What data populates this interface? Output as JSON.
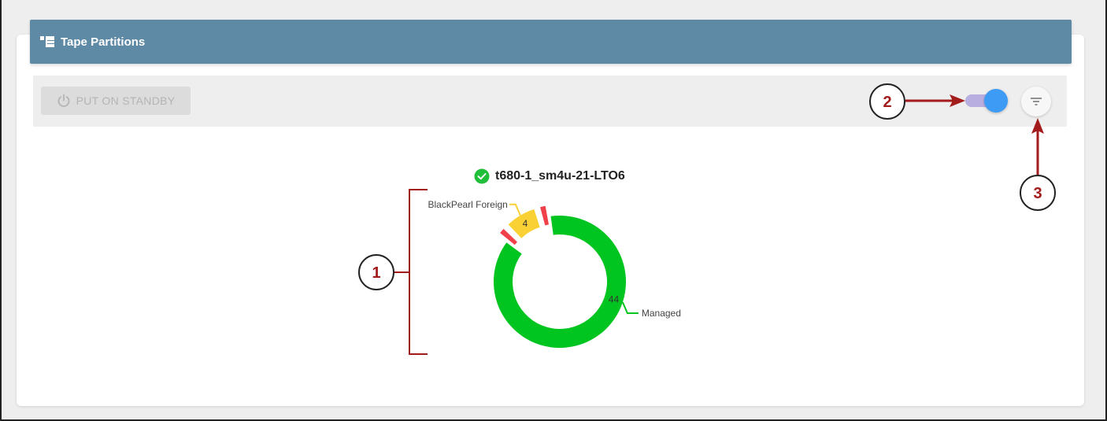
{
  "panel": {
    "title": "Tape Partitions",
    "header_color": "#5f8aa6"
  },
  "toolbar": {
    "standby_label": "PUT ON STANDBY",
    "standby_icon": "power-icon",
    "standby_enabled": false,
    "toggle_on": true,
    "filter_icon": "filter-icon"
  },
  "partition": {
    "name": "t680-1_sm4u-21-LTO6",
    "status_icon": "check-circle-icon",
    "status_color": "#1fbf3a"
  },
  "chart_data": {
    "type": "pie",
    "title": "t680-1_sm4u-21-LTO6",
    "style": "donut",
    "slices": [
      {
        "label": "Managed",
        "value": 44,
        "color": "#00c41f"
      },
      {
        "label": "",
        "value": 1,
        "color": "#f0404a"
      },
      {
        "label": "BlackPearl Foreign",
        "value": 4,
        "color": "#f9d135"
      },
      {
        "label": "",
        "value": 1,
        "color": "#f0404a"
      }
    ]
  },
  "annotations": {
    "callout_1": "1",
    "callout_2": "2",
    "callout_3": "3",
    "color": "#a31b1b"
  }
}
